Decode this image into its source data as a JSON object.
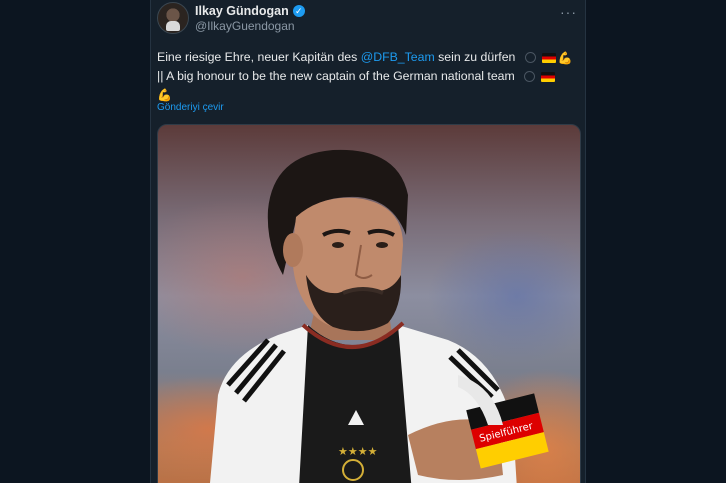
{
  "tweet": {
    "display_name": "Ilkay Gündogan",
    "handle": "@IlkayGuendogan",
    "more_label": "···",
    "verified_glyph": "✓",
    "text_part1": "Eine riesige Ehre, neuer Kapitän des ",
    "mention": "@DFB_Team",
    "text_part2": " sein zu dürfen",
    "text_part3": "|| A big honour to be the new captain of the German national team",
    "translate_label": "Gönderiyi çevir",
    "armband_text": "Spielführer",
    "icons": [
      "more-icon",
      "verified-badge-icon",
      "germany-flag-icon",
      "flexed-biceps-icon"
    ],
    "colors": {
      "link": "#1d9bf0",
      "background": "#15202b",
      "text": "#e7e9ea",
      "muted": "#8b98a5"
    }
  }
}
